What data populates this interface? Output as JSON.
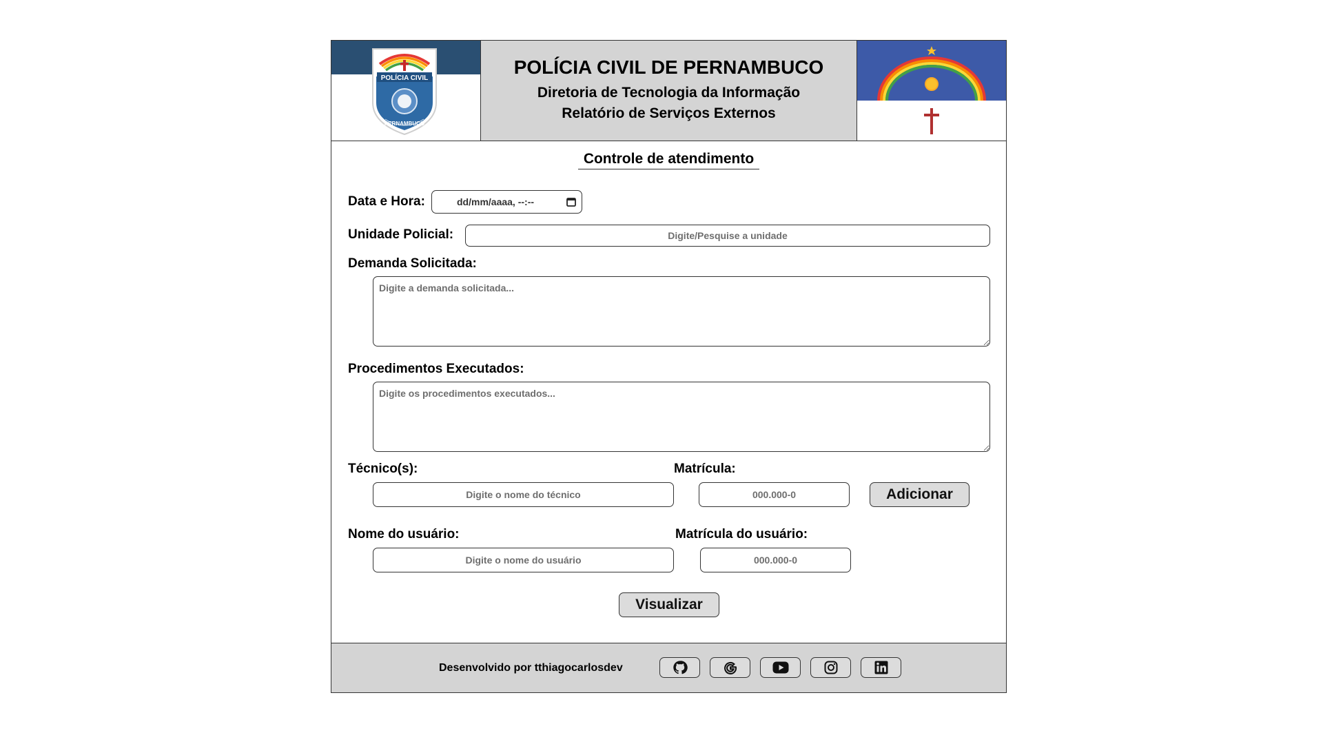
{
  "header": {
    "title": "POLÍCIA CIVIL DE PERNAMBUCO",
    "subtitle": "Diretoria de Tecnologia da Informação",
    "report": "Relatório de Serviços Externos",
    "badge_text_top": "POLÍCIA CIVIL",
    "badge_text_bottom": "PERNAMBUCO"
  },
  "form": {
    "section_title": "Controle de atendimento",
    "datetime": {
      "label": "Data e Hora:",
      "value": "dd/mm/aaaa, --:--"
    },
    "unidade": {
      "label": "Unidade Policial:",
      "placeholder": "Digite/Pesquise a unidade"
    },
    "demanda": {
      "label": "Demanda Solicitada:",
      "placeholder": "Digite a demanda solicitada..."
    },
    "procedimentos": {
      "label": "Procedimentos Executados:",
      "placeholder": "Digite os procedimentos executados..."
    },
    "tecnico": {
      "label": "Técnico(s):",
      "placeholder": "Digite o nome do técnico"
    },
    "matricula": {
      "label": "Matrícula:",
      "placeholder": "000.000-0"
    },
    "add_button": "Adicionar",
    "usuario": {
      "label": "Nome do usuário:",
      "placeholder": "Digite o nome do usuário"
    },
    "matricula_usuario": {
      "label": "Matrícula do usuário:",
      "placeholder": "000.000-0"
    },
    "view_button": "Visualizar"
  },
  "footer": {
    "credit": "Desenvolvido por tthiagocarlosdev",
    "social": [
      "github-icon",
      "google-icon",
      "youtube-icon",
      "instagram-icon",
      "linkedin-icon"
    ]
  },
  "colors": {
    "header_gray": "#d4d4d4",
    "badge_blue": "#2a4f72",
    "flag_blue": "#3d5aa8",
    "flag_red": "#b03030"
  }
}
